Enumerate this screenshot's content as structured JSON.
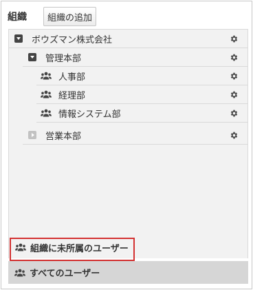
{
  "header": {
    "title": "組織",
    "add_button_label": "組織の追加"
  },
  "tree": {
    "root": {
      "label": "ボウズマン株式会社",
      "state": "expanded"
    },
    "dept_admin": {
      "label": "管理本部",
      "state": "expanded"
    },
    "group_hr": {
      "label": "人事部"
    },
    "group_accounting": {
      "label": "経理部"
    },
    "group_is": {
      "label": "情報システム部"
    },
    "dept_sales": {
      "label": "営業本部",
      "state": "collapsed"
    }
  },
  "bottom": {
    "unassigned_label": "組織に未所属のユーザー",
    "all_users_label": "すべてのユーザー"
  },
  "colors": {
    "panel_bg": "#f2f2f2",
    "selected_bg": "#d6d6d6",
    "highlight_outline": "#d32f2f",
    "icon_dark": "#444444"
  }
}
